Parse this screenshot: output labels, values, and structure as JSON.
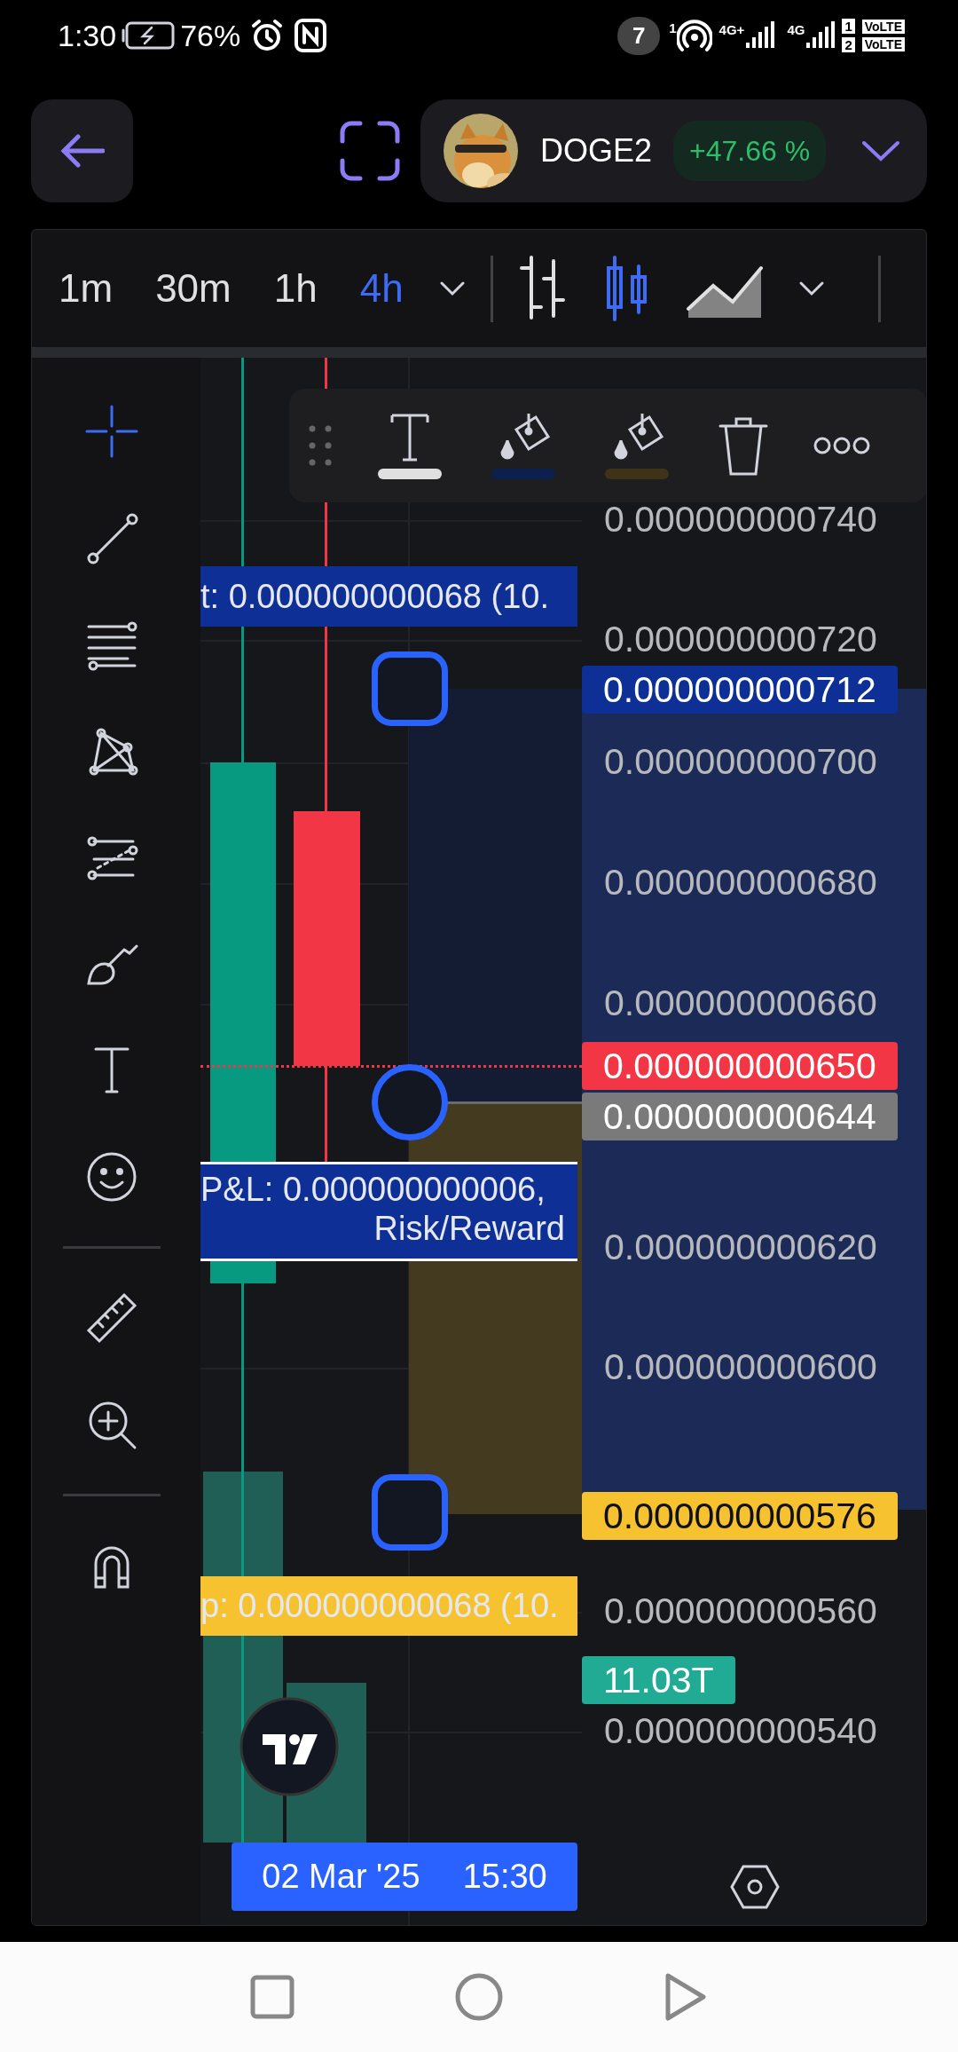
{
  "status_bar": {
    "time": "1:30",
    "battery": "76%",
    "notification_count": "7",
    "sim_marker": "1",
    "network_1": "4G+",
    "network_2": "4G",
    "sim_slots": [
      "1",
      "2"
    ],
    "volte": [
      "VoLTE",
      "VoLTE"
    ]
  },
  "header": {
    "symbol": "DOGE2",
    "change": "+47.66 %"
  },
  "timeframes": [
    {
      "label": "1m",
      "selected": false
    },
    {
      "label": "30m",
      "selected": false
    },
    {
      "label": "1h",
      "selected": false
    },
    {
      "label": "4h",
      "selected": true
    }
  ],
  "chart_types": [
    {
      "kind": "bars",
      "selected": false
    },
    {
      "kind": "candles",
      "selected": true
    },
    {
      "kind": "area",
      "selected": false
    }
  ],
  "drawing_tools": [
    [
      {
        "kind": "crosshair",
        "selected": true
      },
      {
        "kind": "trend_line",
        "selected": false
      },
      {
        "kind": "fib",
        "selected": false
      },
      {
        "kind": "pattern",
        "selected": false
      },
      {
        "kind": "projection",
        "selected": false
      },
      {
        "kind": "brush",
        "selected": false
      },
      {
        "kind": "text",
        "selected": false
      },
      {
        "kind": "emoji",
        "selected": false
      }
    ],
    [
      {
        "kind": "ruler",
        "selected": false
      },
      {
        "kind": "zoom",
        "selected": false
      }
    ],
    [
      {
        "kind": "magnet",
        "selected": false
      }
    ]
  ],
  "floating_toolbar": [
    {
      "kind": "drag"
    },
    {
      "kind": "text"
    },
    {
      "kind": "fill",
      "color": "#0d1f4d"
    },
    {
      "kind": "fill",
      "color": "#3d3418"
    },
    {
      "kind": "delete"
    },
    {
      "kind": "more"
    }
  ],
  "price_axis": [
    {
      "text": "0.000000000740",
      "kind": "tick"
    },
    {
      "text": "0.000000000720",
      "kind": "tick"
    },
    {
      "text": "0.000000000712",
      "kind": "tag",
      "color": "#0d2f96"
    },
    {
      "text": "0.000000000700",
      "kind": "tick"
    },
    {
      "text": "0.000000000680",
      "kind": "tick"
    },
    {
      "text": "0.000000000660",
      "kind": "tick"
    },
    {
      "text": "0.000000000650",
      "kind": "tag",
      "color": "#f23645"
    },
    {
      "text": "0.000000000644",
      "kind": "tag",
      "color": "#7a7a7a"
    },
    {
      "text": "0.000000000620",
      "kind": "tick"
    },
    {
      "text": "0.000000000600",
      "kind": "tick"
    },
    {
      "text": "0.000000000576",
      "kind": "tag",
      "color": "#f7c230"
    },
    {
      "text": "0.000000000560",
      "kind": "tick"
    },
    {
      "text": "11.03T",
      "kind": "tag",
      "color": "#22ab94"
    },
    {
      "text": "0.000000000540",
      "kind": "tick"
    }
  ],
  "position": {
    "target_label": "t: 0.000000000068 (10.",
    "pnl_lines": [
      "P&L: 0.000000000006,",
      "Risk/Reward"
    ],
    "stop_label": "p: 0.000000000068 (10."
  },
  "crosshair": {
    "date": "02 Mar '25",
    "time": "15:30"
  }
}
